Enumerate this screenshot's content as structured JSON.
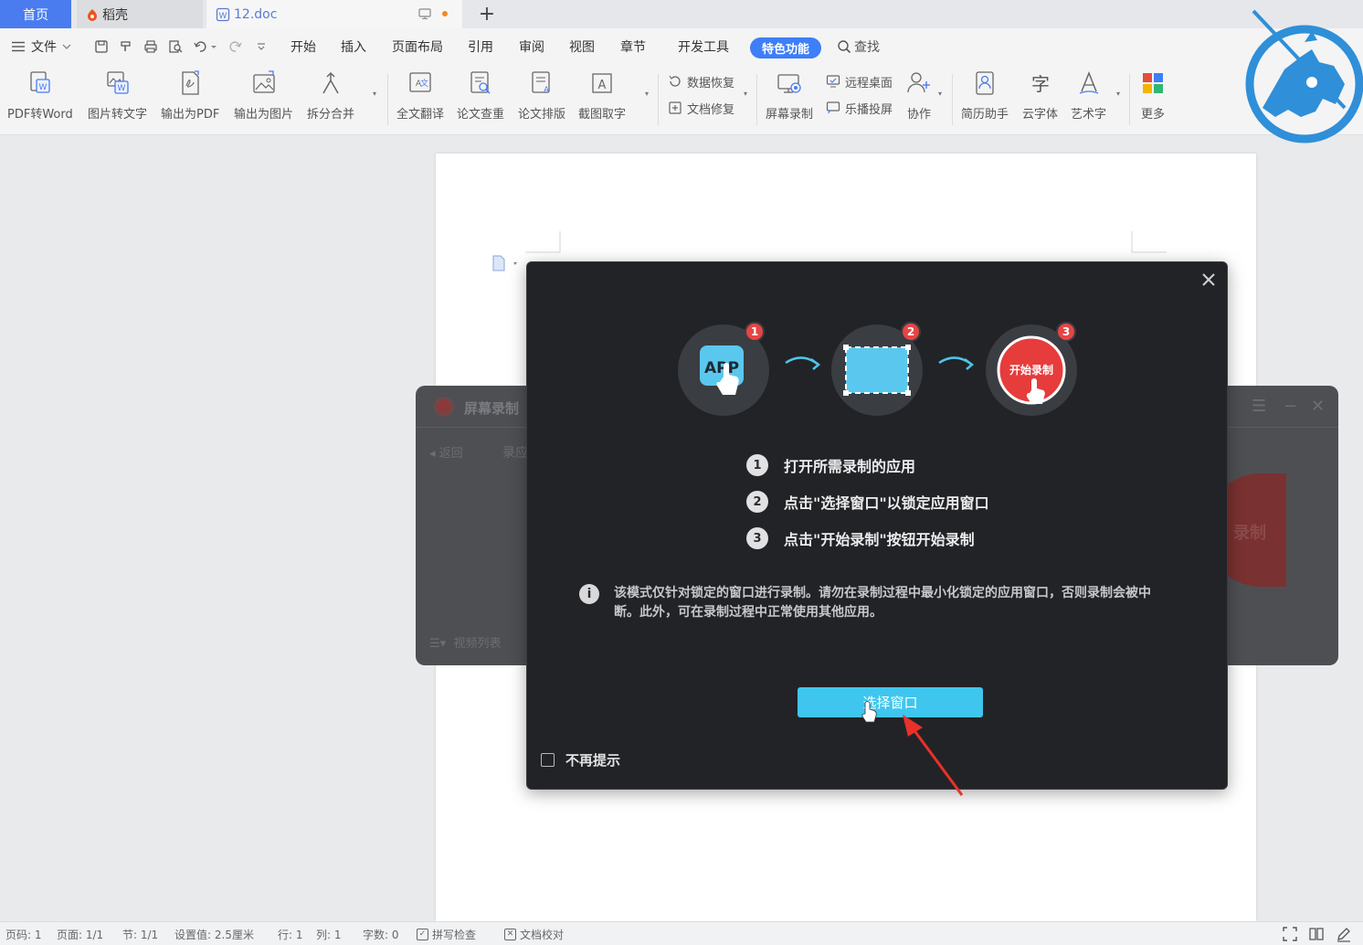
{
  "tabs": {
    "home": "首页",
    "daoke": "稻壳",
    "doc": "12.doc",
    "add": "+"
  },
  "menu": {
    "file": "文件",
    "items": [
      "开始",
      "插入",
      "页面布局",
      "引用",
      "审阅",
      "视图",
      "章节",
      "开发工具"
    ],
    "special": "特色功能",
    "search": "查找"
  },
  "ribbon": {
    "pdf_to_word": "PDF转Word",
    "image_to_text": "图片转文字",
    "export_pdf": "输出为PDF",
    "export_image": "输出为图片",
    "split_merge": "拆分合并",
    "full_translate": "全文翻译",
    "paper_check": "论文查重",
    "paper_layout": "论文排版",
    "screenshot_text": "截图取字",
    "data_recovery": "数据恢复",
    "doc_repair": "文档修复",
    "screen_record": "屏幕录制",
    "remote_desktop": "远程桌面",
    "screen_cast": "乐播投屏",
    "collaborate": "协作",
    "resume_helper": "简历助手",
    "cloud_font": "云字体",
    "art_text": "艺术字",
    "more": "更多"
  },
  "recorder_panel": {
    "title": "屏幕录制",
    "back": "返回",
    "tab": "录应",
    "list": "视频列表",
    "big_button": "录制"
  },
  "modal": {
    "step_badges": [
      "1",
      "2",
      "3"
    ],
    "app_label": "APP",
    "start_label": "开始录制",
    "steps": [
      {
        "num": "1",
        "text": "打开所需录制的应用"
      },
      {
        "num": "2",
        "text": "点击\"选择窗口\"以锁定应用窗口"
      },
      {
        "num": "3",
        "text": "点击\"开始录制\"按钮开始录制"
      }
    ],
    "notice": "该模式仅针对锁定的窗口进行录制。请勿在录制过程中最小化锁定的应用窗口，否则录制会被中断。此外，可在录制过程中正常使用其他应用。",
    "select_button": "选择窗口",
    "no_remind": "不再提示"
  },
  "status": {
    "page_code": "页码: 1",
    "pages": "页面: 1/1",
    "section": "节: 1/1",
    "setting": "设置值: 2.5厘米",
    "row": "行: 1",
    "col": "列: 1",
    "words": "字数: 0",
    "spell_check": "拼写检查",
    "doc_proof": "文档校对"
  },
  "colors": {
    "accent_blue": "#3e7ef8",
    "home_tab": "#4a7cf0",
    "modal_bg": "#222326",
    "select_button": "#3fc6ee",
    "badge_red": "#e84444",
    "logo_blue": "#2f8fd8"
  }
}
